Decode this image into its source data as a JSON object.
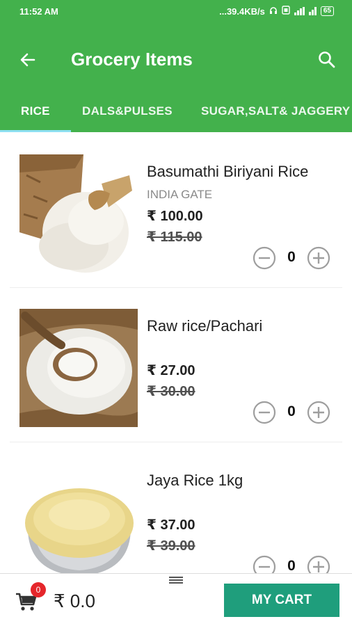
{
  "status_bar": {
    "time": "11:52 AM",
    "network_speed": "...39.4KB/s",
    "battery": "65",
    "icons": [
      "headphones-icon",
      "sim-icon",
      "signal-icon",
      "wifi-icon",
      "battery-icon"
    ]
  },
  "app_bar": {
    "title": "Grocery Items",
    "back_icon": "arrow-left-icon",
    "search_icon": "search-icon",
    "background": "#43b14c"
  },
  "tabs": [
    {
      "label": "RICE",
      "active": true
    },
    {
      "label": "DALS&PULSES",
      "active": false
    },
    {
      "label": "SUGAR,SALT& JAGGERY",
      "active": false
    }
  ],
  "products": [
    {
      "name": "Basumathi Biriyani Rice",
      "brand": "INDIA GATE",
      "price": "₹ 100.00",
      "mrp": "₹ 115.00",
      "quantity": "0"
    },
    {
      "name": "Raw rice/Pachari",
      "brand": "",
      "price": "₹ 27.00",
      "mrp": "₹ 30.00",
      "quantity": "0"
    },
    {
      "name": "Jaya Rice 1kg",
      "brand": "",
      "price": "₹ 37.00",
      "mrp": "₹ 39.00",
      "quantity": "0"
    }
  ],
  "bottom_bar": {
    "cart_count": "0",
    "cart_total": "₹ 0.0",
    "my_cart_label": "MY CART",
    "button_color": "#1f9e7c",
    "badge_color": "#e5262b"
  }
}
